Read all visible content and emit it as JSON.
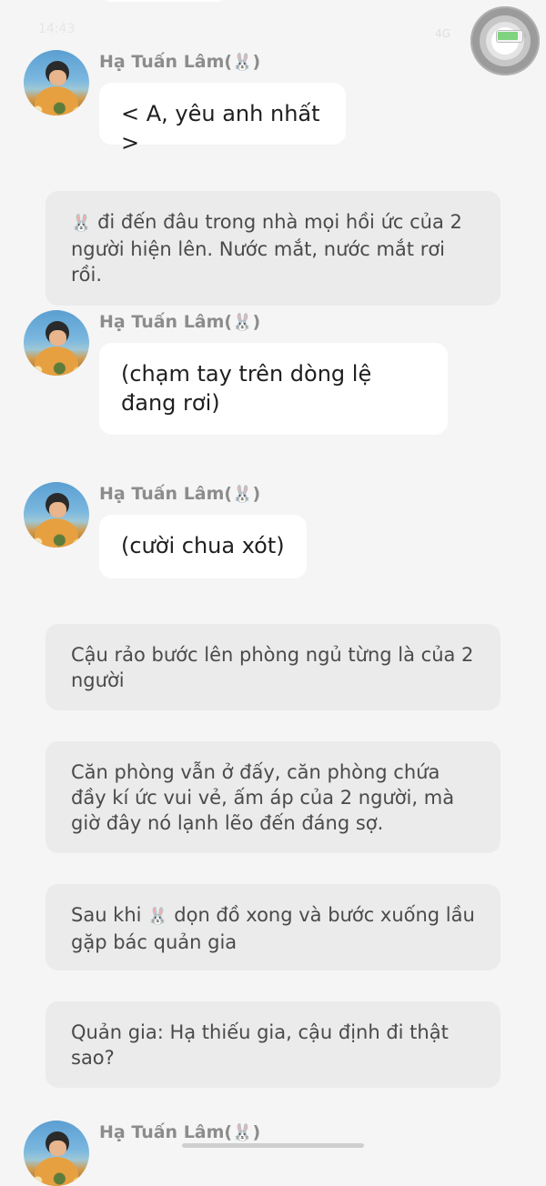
{
  "status_bar": {
    "time": "14:43",
    "signal": "4G",
    "battery_level_percent": 90
  },
  "messages": [
    {
      "type": "character",
      "sender": "Hạ Tuấn Lâm(",
      "sender_suffix": ")",
      "text": "< A, yêu anh nhất >"
    },
    {
      "type": "narration",
      "text_parts": [
        "",
        " đi đến đâu trong nhà mọi hồi ức của 2 người hiện lên. Nước mắt, nước mắt rơi rồi."
      ]
    },
    {
      "type": "character",
      "sender": "Hạ Tuấn Lâm(",
      "sender_suffix": ")",
      "text": "(chạm tay trên dòng lệ đang rơi)"
    },
    {
      "type": "character",
      "sender": "Hạ Tuấn Lâm(",
      "sender_suffix": ")",
      "text": "(cười chua xót)"
    },
    {
      "type": "narration",
      "text": "Cậu rảo bước lên phòng ngủ từng là của 2 người"
    },
    {
      "type": "narration",
      "text": "Căn phòng vẫn ở đấy, căn phòng chứa đầy kí ức vui vẻ, ấm áp của 2 người, mà giờ đây nó lạnh lẽo đến đáng sợ."
    },
    {
      "type": "narration",
      "text_parts": [
        "Sau khi ",
        " dọn đồ xong và bước xuống lầu gặp bác quản gia"
      ]
    },
    {
      "type": "narration",
      "text": "Quản gia: Hạ thiếu gia, cậu định đi thật sao?"
    },
    {
      "type": "character",
      "sender": "Hạ Tuấn Lâm(",
      "sender_suffix": ")",
      "text": ""
    }
  ],
  "icons": {
    "bunny": "🐰"
  }
}
